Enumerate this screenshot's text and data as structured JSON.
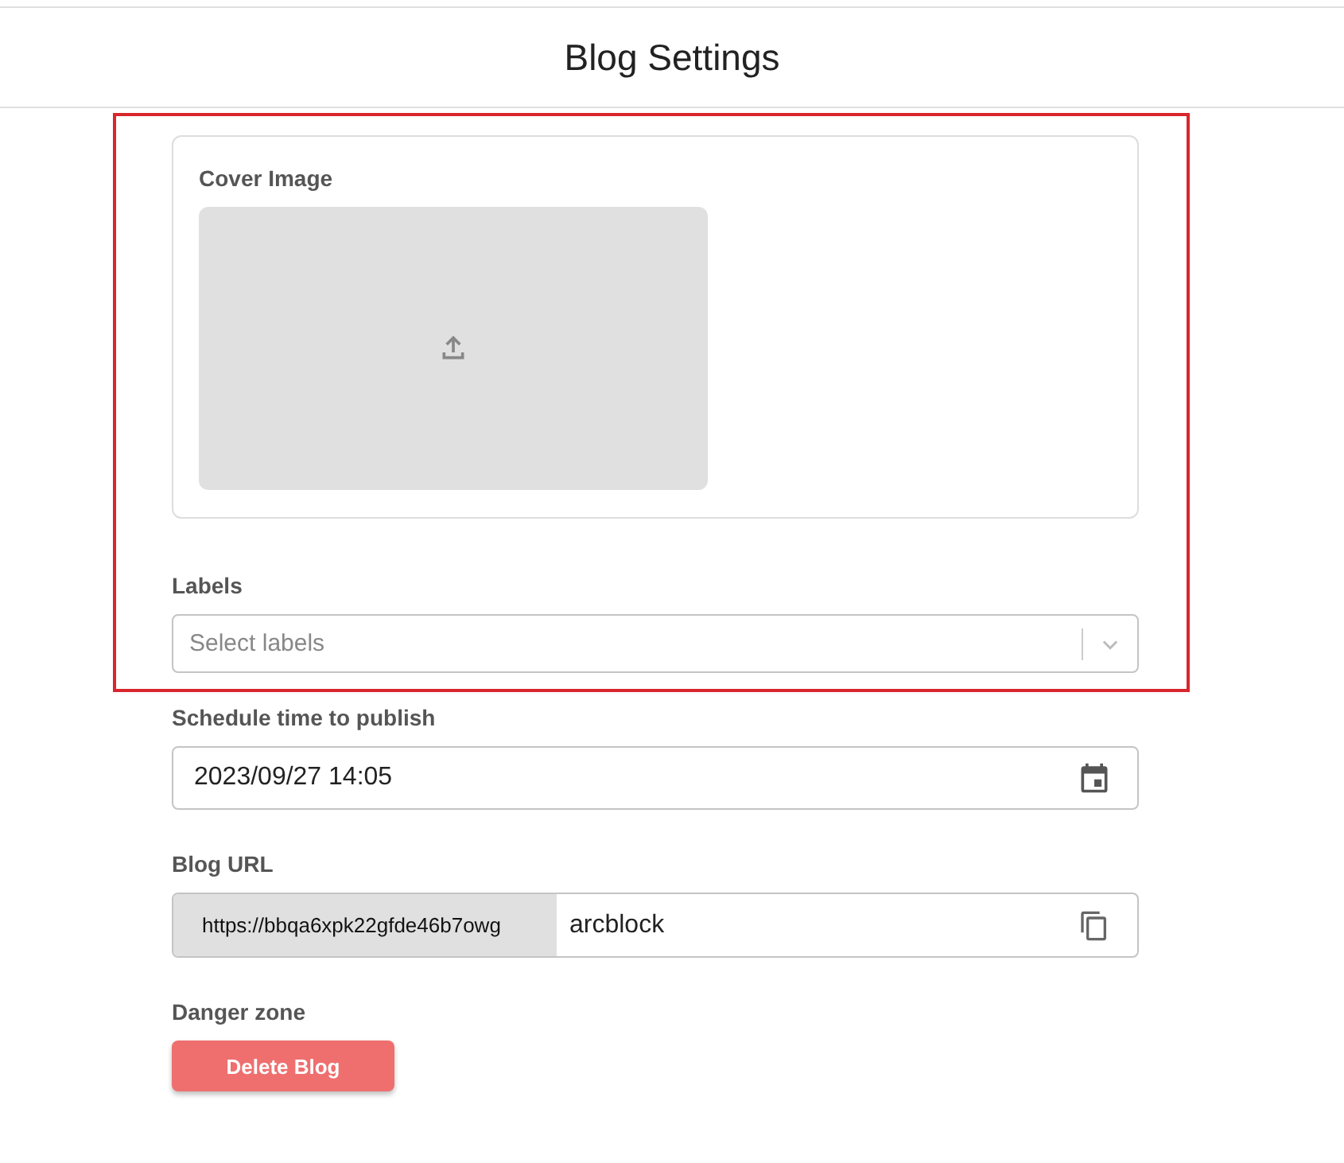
{
  "title": "Blog Settings",
  "cover_image": {
    "label": "Cover Image"
  },
  "labels": {
    "label": "Labels",
    "placeholder": "Select labels"
  },
  "schedule": {
    "label": "Schedule time to publish",
    "value": "2023/09/27 14:05"
  },
  "blog_url": {
    "label": "Blog URL",
    "prefix": "https://bbqa6xpk22gfde46b7owg",
    "value": "arcblock"
  },
  "danger_zone": {
    "label": "Danger zone",
    "button": "Delete Blog"
  }
}
